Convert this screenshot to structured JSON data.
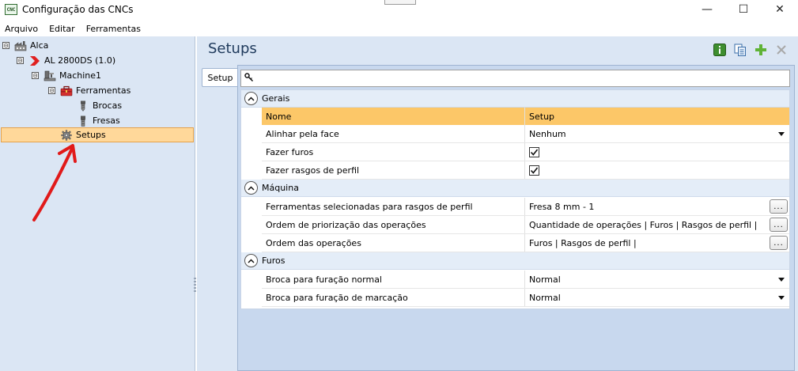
{
  "window": {
    "title": "Configuração das CNCs",
    "app_icon_text": "CNC",
    "controls": {
      "minimize": "—",
      "maximize": "☐",
      "close": "✕"
    }
  },
  "menu": {
    "items": [
      "Arquivo",
      "Editar",
      "Ferramentas"
    ]
  },
  "tree": {
    "nodes": [
      {
        "label": "Alca",
        "icon": "factory-icon",
        "expander": "⊟"
      },
      {
        "label": "AL 2800DS (1.0)",
        "icon": "chevron-red-icon",
        "expander": "⊟"
      },
      {
        "label": "Machine1",
        "icon": "machine-icon",
        "expander": "⊟"
      },
      {
        "label": "Ferramentas",
        "icon": "toolbox-icon",
        "expander": "⊟"
      },
      {
        "label": "Brocas",
        "icon": "drill-bit-icon"
      },
      {
        "label": "Fresas",
        "icon": "mill-bit-icon"
      },
      {
        "label": "Setups",
        "icon": "gear-icon",
        "selected": true
      }
    ]
  },
  "pane": {
    "title": "Setups",
    "toolbar": [
      "info-icon",
      "copy-icon",
      "add-icon",
      "delete-icon"
    ],
    "tab_label": "Setup",
    "search_placeholder": ""
  },
  "grid": {
    "header": {
      "name": "Nome",
      "value": "Setup"
    },
    "groups": [
      {
        "label": "Gerais",
        "rows": [
          {
            "name": "Alinhar pela face",
            "value": "Nenhum",
            "editor": "dropdown"
          },
          {
            "name": "Fazer furos",
            "value": "",
            "editor": "checkbox",
            "checked": true
          },
          {
            "name": "Fazer rasgos de perfil",
            "value": "",
            "editor": "checkbox",
            "checked": true
          }
        ]
      },
      {
        "label": "Máquina",
        "rows": [
          {
            "name": "Ferramentas selecionadas para rasgos de perfil",
            "value": "Fresa 8 mm - 1",
            "editor": "ellipsis"
          },
          {
            "name": "Ordem de priorização das operações",
            "value": "Quantidade de operações | Furos | Rasgos de perfil |",
            "editor": "ellipsis"
          },
          {
            "name": "Ordem das operações",
            "value": "Furos | Rasgos de perfil |",
            "editor": "ellipsis"
          }
        ]
      },
      {
        "label": "Furos",
        "rows": [
          {
            "name": "Broca para furação normal",
            "value": "Normal",
            "editor": "dropdown"
          },
          {
            "name": "Broca para furação de marcação",
            "value": "Normal",
            "editor": "dropdown"
          }
        ]
      }
    ],
    "ellipsis_label": "..."
  },
  "colors": {
    "selection_fill": "#ffd89a",
    "header_fill": "#fcc768",
    "annotation_arrow": "#e11a1a",
    "pane_title": "#1e395b"
  }
}
